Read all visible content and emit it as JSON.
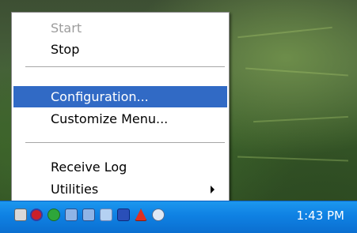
{
  "context_menu": {
    "items": [
      {
        "label": "Start",
        "disabled": true
      },
      {
        "label": "Stop",
        "disabled": false
      },
      {
        "label": "Configuration...",
        "selected": true
      },
      {
        "label": "Customize Menu..."
      },
      {
        "label": "Receive Log"
      },
      {
        "label": "Utilities",
        "has_submenu": true
      }
    ]
  },
  "taskbar": {
    "clock": "1:43 PM",
    "tray_icons": [
      "network-icon",
      "shield-icon",
      "green-status-icon",
      "network-connections-icon",
      "network-connections-icon-2",
      "app-icon",
      "security-center-icon",
      "alert-icon",
      "volume-icon"
    ],
    "bar_color": "#0f81e3"
  },
  "colors": {
    "selection": "#316ac5",
    "disabled_text": "#9c9c9c"
  }
}
